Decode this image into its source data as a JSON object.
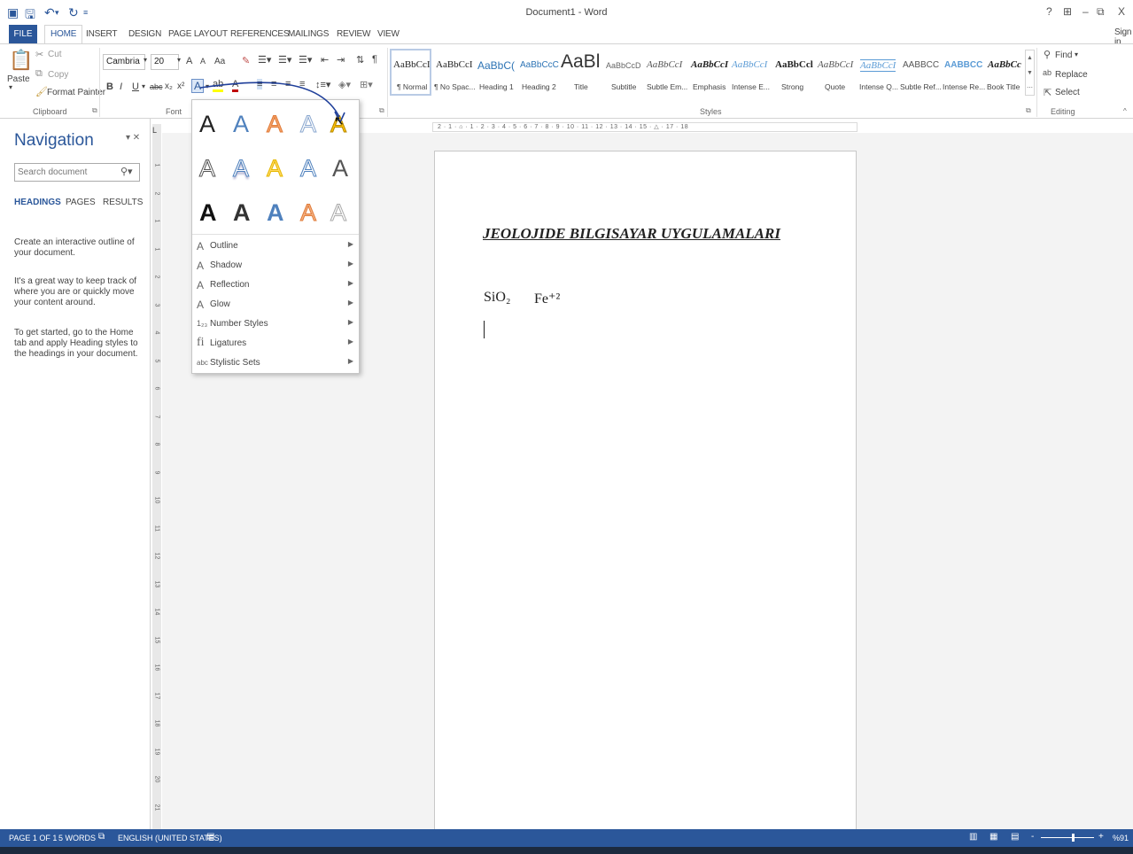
{
  "window": {
    "title": "Document1 - Word",
    "sign_in": "Sign in",
    "help": "?",
    "minimize": "–",
    "restore": "⧉",
    "close": "X"
  },
  "tabs": {
    "file": "FILE",
    "items": [
      "HOME",
      "INSERT",
      "DESIGN",
      "PAGE LAYOUT",
      "REFERENCES",
      "MAILINGS",
      "REVIEW",
      "VIEW"
    ]
  },
  "clipboard": {
    "paste": "Paste",
    "cut": "Cut",
    "copy": "Copy",
    "format_painter": "Format Painter",
    "label": "Clipboard"
  },
  "font": {
    "name": "Cambria",
    "size": "20",
    "label": "Font",
    "bold": "B",
    "italic": "I",
    "underline": "U",
    "strike": "abc",
    "subscript": "x₂",
    "superscript": "x²",
    "grow": "A",
    "shrink": "A",
    "case": "Aa"
  },
  "styles": {
    "label": "Styles",
    "items": [
      {
        "preview": "AaBbCcI",
        "name": "¶ Normal"
      },
      {
        "preview": "AaBbCcI",
        "name": "¶ No Spac..."
      },
      {
        "preview": "AaBbC(",
        "name": "Heading 1"
      },
      {
        "preview": "AaBbCcC",
        "name": "Heading 2"
      },
      {
        "preview": "AaBl",
        "name": "Title"
      },
      {
        "preview": "AaBbCcD",
        "name": "Subtitle"
      },
      {
        "preview": "AaBbCcI",
        "name": "Subtle Em..."
      },
      {
        "preview": "AaBbCcI",
        "name": "Emphasis"
      },
      {
        "preview": "AaBbCcI",
        "name": "Intense E..."
      },
      {
        "preview": "AaBbCcl",
        "name": "Strong"
      },
      {
        "preview": "AaBbCcI",
        "name": "Quote"
      },
      {
        "preview": "AaBbCcI",
        "name": "Intense Q..."
      },
      {
        "preview": "AABBCC",
        "name": "Subtle Ref..."
      },
      {
        "preview": "AABBCC",
        "name": "Intense Re..."
      },
      {
        "preview": "AaBbCc",
        "name": "Book Title"
      }
    ]
  },
  "editing": {
    "find": "Find",
    "replace": "Replace",
    "select": "Select",
    "label": "Editing"
  },
  "navigation": {
    "title": "Navigation",
    "search_placeholder": "Search document",
    "tabs": [
      "HEADINGS",
      "PAGES",
      "RESULTS"
    ],
    "p1": "Create an interactive outline of your document.",
    "p2": "It's a great way to keep track of where you are or quickly move your content around.",
    "p3": "To get started, go to the Home tab and apply Heading styles to the headings in your document."
  },
  "ruler": {
    "h": "2 · 1 · ⌂ · 1 · 2 · 3 · 4 · 5 · 6 · 7 · 8 · 9 · 10 · 11 · 12 · 13 · 14 · 15 · △ · 17 · 18",
    "v": [
      "1",
      "2",
      "1",
      "1",
      "2",
      "3",
      "4",
      "5",
      "6",
      "7",
      "8",
      "9",
      "10",
      "11",
      "12",
      "13",
      "14",
      "15",
      "16",
      "17",
      "18",
      "19",
      "20",
      "21"
    ]
  },
  "document": {
    "heading": "JEOLOJIDE BILGISAYAR UYGULAMALARI",
    "sio2": "SiO₂",
    "fe": "Fe⁺²"
  },
  "text_effects": {
    "menu": [
      {
        "label": "Outline",
        "icon": "A"
      },
      {
        "label": "Shadow",
        "icon": "A"
      },
      {
        "label": "Reflection",
        "icon": "A"
      },
      {
        "label": "Glow",
        "icon": "A"
      },
      {
        "label": "Number Styles",
        "icon": "1₂₃"
      },
      {
        "label": "Ligatures",
        "icon": "fi"
      },
      {
        "label": "Stylistic Sets",
        "icon": "abc"
      }
    ]
  },
  "status": {
    "page": "PAGE 1 OF 1",
    "words": "5 WORDS",
    "language": "ENGLISH (UNITED STATES)",
    "zoom": "%91"
  },
  "colors": {
    "accent": "#2b579a",
    "status_bar": "#2b579a"
  }
}
